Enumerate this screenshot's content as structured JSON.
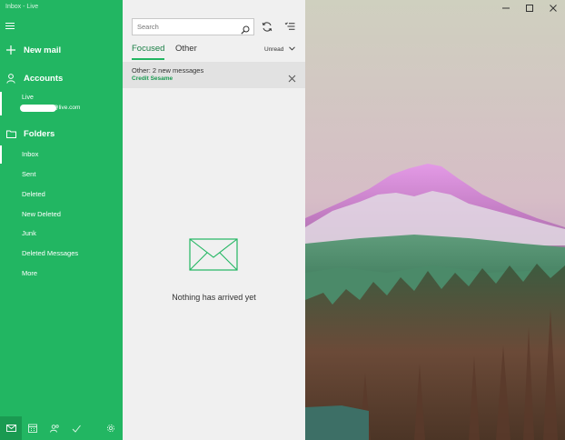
{
  "window": {
    "title": "Inbox - Live"
  },
  "sidebar": {
    "new_mail": "New mail",
    "accounts_heading": "Accounts",
    "account": {
      "name": "Live",
      "email_suffix": "@live.com"
    },
    "folders_heading": "Folders",
    "folders": [
      "Inbox",
      "Sent",
      "Deleted",
      "New Deleted",
      "Junk",
      "Deleted Messages",
      "More"
    ],
    "bottom_icons": [
      "mail-icon",
      "calendar-icon",
      "people-icon",
      "todo-icon",
      "settings-icon"
    ]
  },
  "message_list": {
    "search_placeholder": "Search",
    "tabs": [
      "Focused",
      "Other"
    ],
    "filter_label": "Unread",
    "notice": {
      "title": "Other: 2 new messages",
      "sender": "Credit Sesame"
    },
    "empty_message": "Nothing has arrived yet"
  },
  "colors": {
    "accent": "#22b662",
    "panel": "#f0f0f0"
  }
}
